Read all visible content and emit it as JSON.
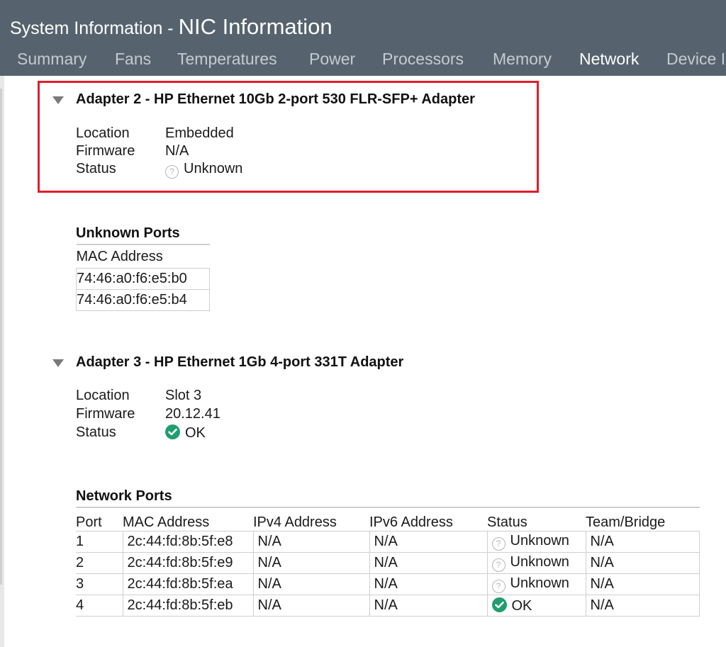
{
  "window": {
    "title_part1": "System Information - ",
    "title_part2": "NIC Information"
  },
  "tabs": [
    {
      "label": "Summary"
    },
    {
      "label": "Fans"
    },
    {
      "label": "Temperatures"
    },
    {
      "label": "Power"
    },
    {
      "label": "Processors"
    },
    {
      "label": "Memory"
    },
    {
      "label": "Network",
      "active": true
    },
    {
      "label": "Device I"
    }
  ],
  "adapter2": {
    "title": "Adapter 2 - HP Ethernet 10Gb 2-port 530 FLR-SFP+ Adapter",
    "location_label": "Location",
    "location_value": "Embedded",
    "firmware_label": "Firmware",
    "firmware_value": "N/A",
    "status_label": "Status",
    "status_value": "Unknown",
    "status_icon": "question-circle-icon"
  },
  "unknown_ports": {
    "title": "Unknown Ports",
    "column": "MAC Address",
    "rows": [
      "74:46:a0:f6:e5:b0",
      "74:46:a0:f6:e5:b4"
    ]
  },
  "adapter3": {
    "title": "Adapter 3 - HP Ethernet 1Gb 4-port 331T Adapter",
    "location_label": "Location",
    "location_value": "Slot 3",
    "firmware_label": "Firmware",
    "firmware_value": "20.12.41",
    "status_label": "Status",
    "status_value": "OK",
    "status_icon": "check-circle-icon"
  },
  "network_ports": {
    "title": "Network Ports",
    "columns": [
      "Port",
      "MAC Address",
      "IPv4 Address",
      "IPv6 Address",
      "Status",
      "Team/Bridge"
    ],
    "rows": [
      {
        "port": "1",
        "mac": "2c:44:fd:8b:5f:e8",
        "ipv4": "N/A",
        "ipv6": "N/A",
        "status": "Unknown",
        "team": "N/A"
      },
      {
        "port": "2",
        "mac": "2c:44:fd:8b:5f:e9",
        "ipv4": "N/A",
        "ipv6": "N/A",
        "status": "Unknown",
        "team": "N/A"
      },
      {
        "port": "3",
        "mac": "2c:44:fd:8b:5f:ea",
        "ipv4": "N/A",
        "ipv6": "N/A",
        "status": "Unknown",
        "team": "N/A"
      },
      {
        "port": "4",
        "mac": "2c:44:fd:8b:5f:eb",
        "ipv4": "N/A",
        "ipv6": "N/A",
        "status": "OK",
        "team": "N/A"
      }
    ]
  },
  "colors": {
    "header_bg": "#56636e",
    "tab_inactive": "#c4cbd0",
    "tab_active": "#ffffff",
    "highlight": "#e01e2a",
    "ok_green": "#1f9e6e"
  }
}
